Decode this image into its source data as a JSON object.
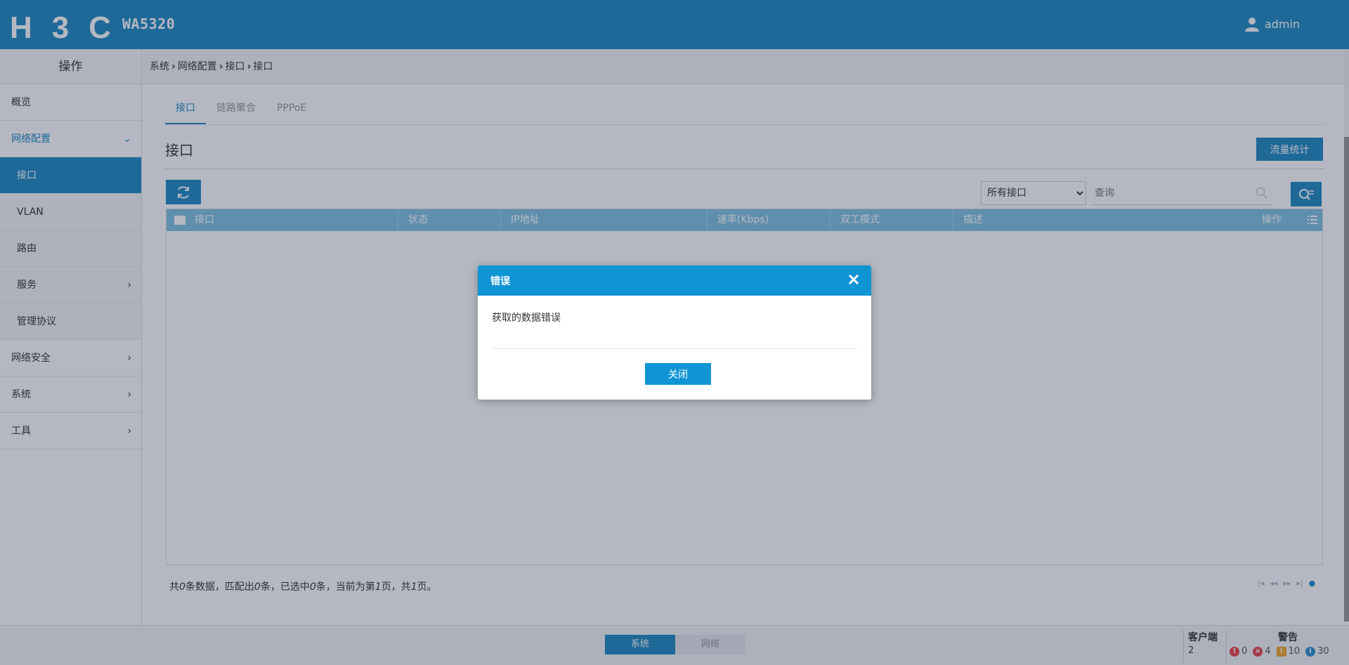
{
  "header": {
    "logo_text": "H3C",
    "model": "WA5320",
    "user": "admin"
  },
  "sidebar": {
    "title": "操作",
    "items": [
      {
        "label": "概览",
        "arrow": ""
      },
      {
        "label": "网络配置",
        "arrow": "⌄"
      },
      {
        "label": "接口",
        "arrow": ""
      },
      {
        "label": "VLAN",
        "arrow": ""
      },
      {
        "label": "路由",
        "arrow": ""
      },
      {
        "label": "服务",
        "arrow": "›"
      },
      {
        "label": "管理协议",
        "arrow": ""
      },
      {
        "label": "网络安全",
        "arrow": "›"
      },
      {
        "label": "系统",
        "arrow": "›"
      },
      {
        "label": "工具",
        "arrow": "›"
      }
    ]
  },
  "breadcrumb": [
    "系统",
    "网络配置",
    "接口",
    "接口"
  ],
  "tabs": [
    "接口",
    "链路聚合",
    "PPPoE"
  ],
  "section_title": "接口",
  "stats_button": "流量统计",
  "filter": {
    "selected": "所有接口",
    "search_placeholder": "查询"
  },
  "table": {
    "columns": [
      "接口",
      "状态",
      "IP地址",
      "速率(Kbps)",
      "双工模式",
      "描述",
      "操作"
    ],
    "rows": []
  },
  "pager": {
    "p1": "共",
    "total": "0",
    "p2": "条数据，匹配出",
    "matched": "0",
    "p3": "条，已选中",
    "selected": "0",
    "p4": "条，当前为第",
    "current": "1",
    "p5": "页，共",
    "pages": "1",
    "p6": "页。"
  },
  "footer": {
    "tabs": [
      "系统",
      "网络"
    ],
    "clients_label": "客户端",
    "clients_count": "2",
    "alarm_label": "警告",
    "alarms": [
      {
        "icon": "critical-icon",
        "count": "0",
        "color": "#e8434b"
      },
      {
        "icon": "error-icon",
        "count": "4",
        "color": "#e8434b"
      },
      {
        "icon": "warning-icon",
        "count": "10",
        "color": "#f0a92c"
      },
      {
        "icon": "info-icon",
        "count": "30",
        "color": "#2a8fd0"
      }
    ]
  },
  "dialog": {
    "title": "错误",
    "message": "获取的数据错误",
    "close_button": "关闭"
  },
  "colors": {
    "brand": "#1f8ac0",
    "dialog_header": "#0f95d4",
    "table_header": "#7fc2e0"
  }
}
